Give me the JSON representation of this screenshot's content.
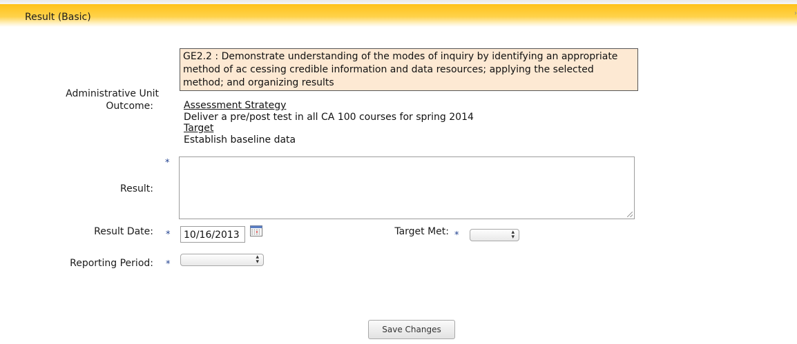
{
  "header": {
    "title": "Result (Basic)"
  },
  "form": {
    "outcome_label_line1": "Administrative Unit",
    "outcome_label_line2": "Outcome:",
    "outcome_text": "GE2.2 : Demonstrate understanding of the modes of inquiry by identifying an appropriate method of ac cessing credible information and data resources; applying the selected method; and organizing results",
    "assessment_strategy_heading": "Assessment Strategy",
    "assessment_strategy_text": "Deliver a pre/post test in all CA 100 courses for spring 2014",
    "target_heading": "Target",
    "target_text": "Establish baseline data",
    "required_marker": "*",
    "result_label": "Result:",
    "result_value": "",
    "result_date_label": "Result Date:",
    "result_date_value": "10/16/2013",
    "target_met_label": "Target Met:",
    "target_met_value": "",
    "reporting_period_label": "Reporting Period:",
    "reporting_period_value": ""
  },
  "actions": {
    "save_label": "Save Changes"
  },
  "icons": {
    "calendar": "calendar-icon",
    "select_arrows": "updown-arrows-icon"
  },
  "colors": {
    "header_bar": "#ffc21a",
    "outcome_box_bg": "#fde9d3",
    "required_marker": "#1f3f8f"
  }
}
